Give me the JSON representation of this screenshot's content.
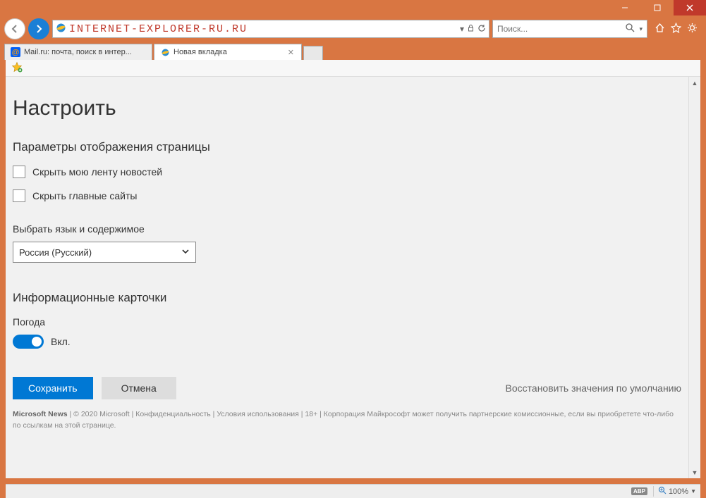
{
  "address_bar": {
    "url": "INTERNET-EXPLORER-RU.RU"
  },
  "search": {
    "placeholder": "Поиск..."
  },
  "tabs": [
    {
      "label": "Mail.ru: почта, поиск в интер...",
      "active": false
    },
    {
      "label": "Новая вкладка",
      "active": true
    }
  ],
  "page": {
    "title": "Настроить",
    "section_display": "Параметры отображения страницы",
    "check_hide_feed": "Скрыть мою ленту новостей",
    "check_hide_sites": "Скрыть главные сайты",
    "lang_label": "Выбрать язык и содержимое",
    "lang_value": "Россия (Русский)",
    "cards_heading": "Информационные карточки",
    "weather_label": "Погода",
    "toggle_state": "Вкл.",
    "save_btn": "Сохранить",
    "cancel_btn": "Отмена",
    "restore_defaults": "Восстановить значения по умолчанию"
  },
  "footer": {
    "brand": "Microsoft News",
    "text": " | © 2020 Microsoft | Конфиденциальность | Условия использования | 18+ | Корпорация Майкрософт может получить партнерские комиссионные, если вы приобретете что-либо по ссылкам на этой странице."
  },
  "status": {
    "abp": "ABP",
    "zoom": "100%"
  }
}
